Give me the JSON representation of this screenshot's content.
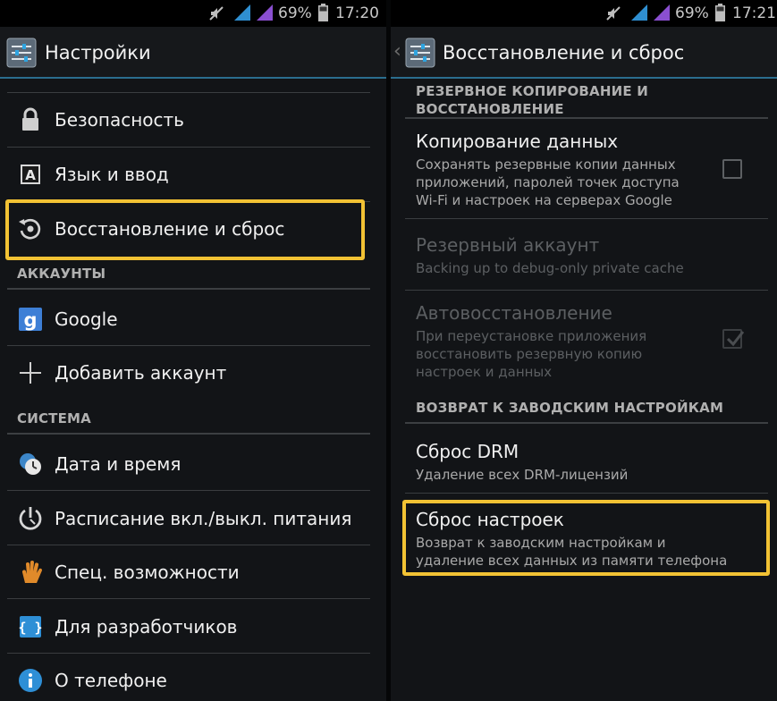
{
  "left": {
    "status": {
      "battery": "69%",
      "time": "17:20"
    },
    "title": "Настройки",
    "items": [
      {
        "label": "Безопасность",
        "icon": "lock-icon"
      },
      {
        "label": "Язык и ввод",
        "icon": "keyboard-a-icon"
      },
      {
        "label": "Восстановление и сброс",
        "icon": "backup-restore-icon"
      }
    ],
    "sections": {
      "accounts": "АККАУНТЫ",
      "system": "СИСТЕМА"
    },
    "account_items": [
      {
        "label": "Google",
        "icon": "google-g-icon"
      },
      {
        "label": "Добавить аккаунт",
        "icon": "plus-icon"
      }
    ],
    "system_items": [
      {
        "label": "Дата и время",
        "icon": "clock-icon"
      },
      {
        "label": "Расписание вкл./выкл. питания",
        "icon": "power-schedule-icon"
      },
      {
        "label": "Спец. возможности",
        "icon": "hand-icon"
      },
      {
        "label": "Для разработчиков",
        "icon": "braces-icon"
      },
      {
        "label": "О телефоне",
        "icon": "info-icon"
      }
    ]
  },
  "right": {
    "status": {
      "battery": "69%",
      "time": "17:21"
    },
    "back": "‹",
    "title": "Восстановление и сброс",
    "section_backup": {
      "line1": "РЕЗЕРВНОЕ КОПИРОВАНИЕ И",
      "line2": "ВОССТАНОВЛЕНИЕ"
    },
    "copy_data": {
      "title": "Копирование данных",
      "summary": [
        "Сохранять резервные копии данных",
        "приложений, паролей точек доступа",
        "Wi-Fi и настроек на серверах Google"
      ],
      "checked": false
    },
    "backup_account": {
      "title": "Резервный аккаунт",
      "summary": "Backing up to debug-only private cache"
    },
    "auto_restore": {
      "title": "Автовосстановление",
      "summary": [
        "При переустановке приложения",
        "восстановить резервную копию",
        "настроек и данных"
      ],
      "checked": true
    },
    "section_factory": "ВОЗВРАТ К ЗАВОДСКИМ НАСТРОЙКАМ",
    "drm_reset": {
      "title": "Сброс DRM",
      "summary": "Удаление всех DRM-лицензий"
    },
    "factory_reset": {
      "title": "Сброс настроек",
      "summary": [
        "Возврат к заводским настройкам и",
        "удаление всех данных из памяти телефона"
      ]
    }
  },
  "colors": {
    "highlight": "#f2c234",
    "accent": "#2b6e8f",
    "background": "#121417"
  }
}
